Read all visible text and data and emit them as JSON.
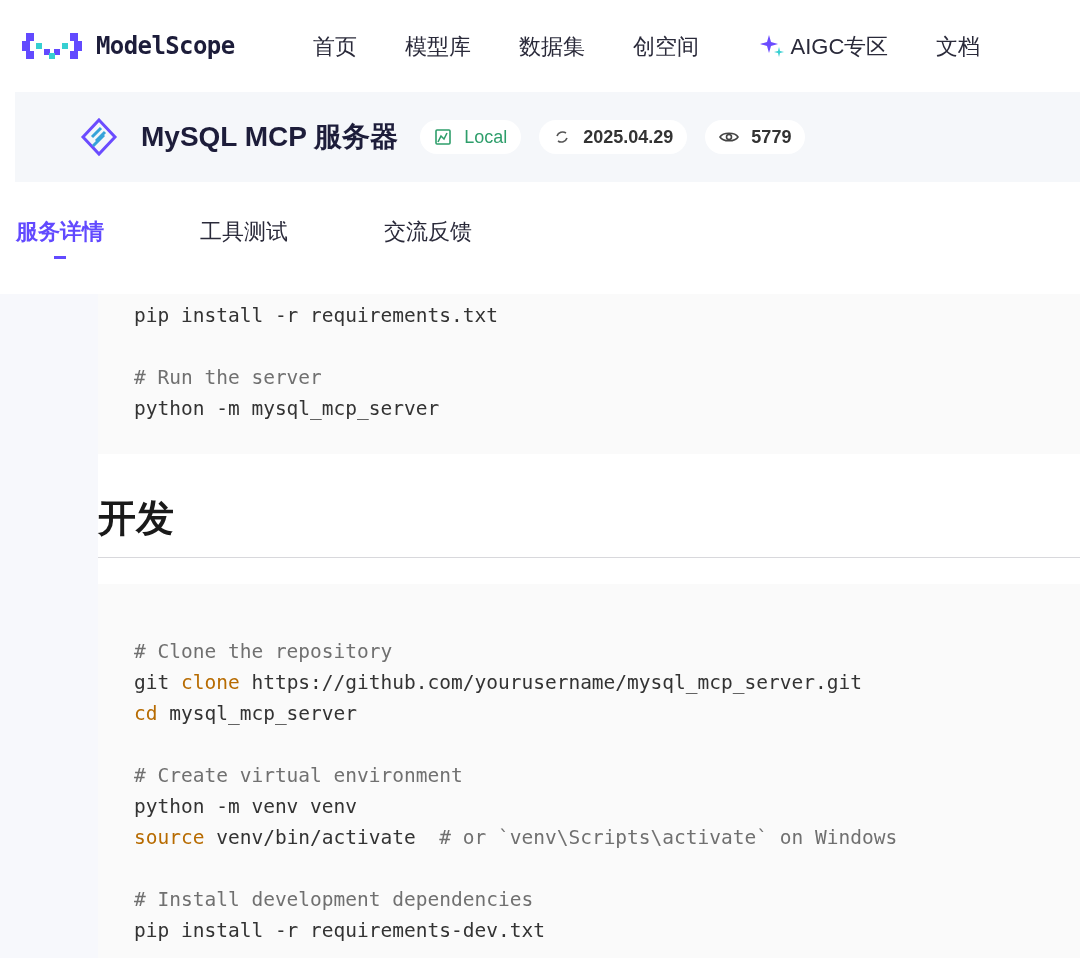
{
  "nav": {
    "brand": "ModelScope",
    "items": [
      {
        "label": "首页",
        "kind": "plain"
      },
      {
        "label": "模型库",
        "kind": "plain"
      },
      {
        "label": "数据集",
        "kind": "plain"
      },
      {
        "label": "创空间",
        "kind": "plain"
      },
      {
        "label": "AIGC专区",
        "kind": "sparkle"
      },
      {
        "label": "文档",
        "kind": "plain"
      }
    ]
  },
  "server": {
    "title": "MySQL MCP 服务器",
    "badges": [
      {
        "kind": "local",
        "text": "Local"
      },
      {
        "kind": "date",
        "text": "2025.04.29"
      },
      {
        "kind": "views",
        "text": "5779"
      }
    ]
  },
  "tabs": [
    {
      "label": "服务详情",
      "selected": true
    },
    {
      "label": "工具测试",
      "selected": false
    },
    {
      "label": "交流反馈",
      "selected": false
    }
  ],
  "code_top": [
    [
      [
        {
          "kind": "plain",
          "text": "pip install -r requirements.txt"
        }
      ]
    ],
    [
      [
        {
          "kind": "comment",
          "text": "# Run the server"
        }
      ],
      [
        {
          "kind": "plain",
          "text": "python -m mysql_mcp_server"
        }
      ]
    ]
  ],
  "section_heading": "开发",
  "code_dev": [
    [
      [
        {
          "kind": "comment",
          "text": "# Clone the repository"
        }
      ],
      [
        {
          "kind": "plain",
          "text": "git "
        },
        {
          "kind": "keyword",
          "text": "clone"
        },
        {
          "kind": "plain",
          "text": " https://github.com/yourusername/mysql_mcp_server.git"
        }
      ],
      [
        {
          "kind": "keyword",
          "text": "cd"
        },
        {
          "kind": "plain",
          "text": " mysql_mcp_server"
        }
      ]
    ],
    [
      [
        {
          "kind": "comment",
          "text": "# Create virtual environment"
        }
      ],
      [
        {
          "kind": "plain",
          "text": "python -m venv venv"
        }
      ],
      [
        {
          "kind": "keyword",
          "text": "source"
        },
        {
          "kind": "plain",
          "text": " venv/bin/activate  "
        },
        {
          "kind": "comment",
          "text": "# or `venv\\Scripts\\activate` on Windows"
        }
      ]
    ],
    [
      [
        {
          "kind": "comment",
          "text": "# Install development dependencies"
        }
      ],
      [
        {
          "kind": "plain",
          "text": "pip install -r requirements-dev.txt"
        }
      ]
    ]
  ]
}
